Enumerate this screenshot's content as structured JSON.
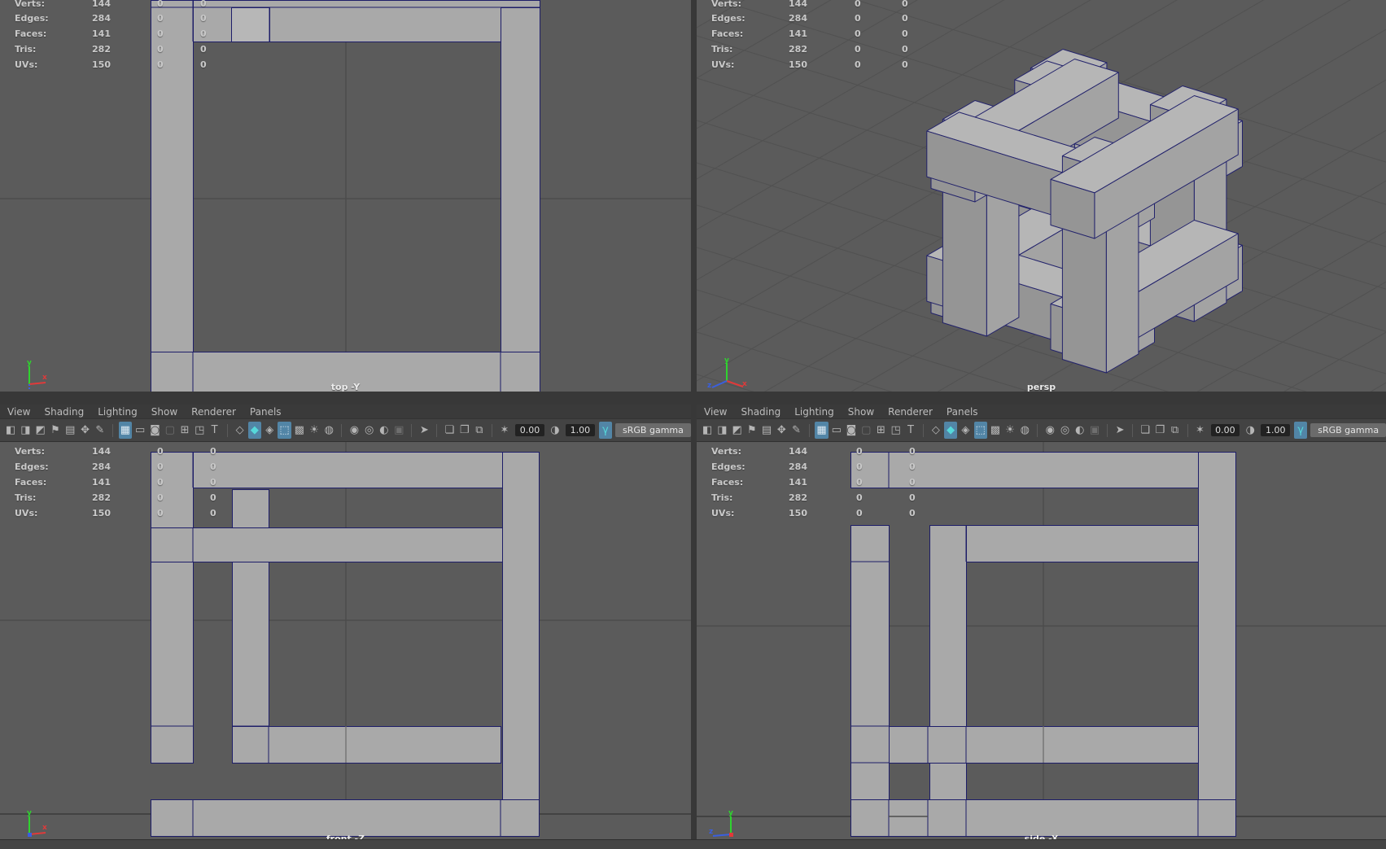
{
  "colors": {
    "viewport_bg": "#5b5b5b",
    "wireframe_edge": "#1d1d68",
    "mesh_fill": "#a9a9a9",
    "accent_highlight": "#5285a6",
    "teal_highlight": "#56d8da",
    "chrome": "#3a3a3a"
  },
  "menus": [
    "View",
    "Shading",
    "Lighting",
    "Show",
    "Renderer",
    "Panels"
  ],
  "stats": {
    "labels": [
      "Verts:",
      "Edges:",
      "Faces:",
      "Tris:",
      "UVs:"
    ],
    "values": [
      "144",
      "284",
      "141",
      "282",
      "150"
    ],
    "zero": "0"
  },
  "viewports": {
    "top": "top -Y",
    "persp": "persp",
    "front": "front -Z",
    "side": "side -X"
  },
  "axis": {
    "x": "x",
    "y": "y",
    "z": "z"
  },
  "toolbar": {
    "exposure": "0.00",
    "gamma": "1.00",
    "colorspace": "sRGB gamma",
    "icons": [
      {
        "type": "icon",
        "name": "camera-icon",
        "glyph": "◧"
      },
      {
        "type": "icon",
        "name": "camera-lock-icon",
        "glyph": "◨"
      },
      {
        "type": "icon",
        "name": "camera-settings-icon",
        "glyph": "◩"
      },
      {
        "type": "icon",
        "name": "bookmark-icon",
        "glyph": "⚑"
      },
      {
        "type": "icon",
        "name": "image-plane-icon",
        "glyph": "▤"
      },
      {
        "type": "icon",
        "name": "pan-zoom-icon",
        "glyph": "✥"
      },
      {
        "type": "icon",
        "name": "grease-pencil-icon",
        "glyph": "✎"
      },
      {
        "type": "sep"
      },
      {
        "type": "icon",
        "name": "grid-icon",
        "glyph": "▦",
        "state": "active"
      },
      {
        "type": "icon",
        "name": "film-gate-icon",
        "glyph": "▭"
      },
      {
        "type": "icon",
        "name": "resolution-gate-icon",
        "glyph": "◙"
      },
      {
        "type": "icon",
        "name": "gate-mask-icon",
        "glyph": "▢",
        "state": "dim"
      },
      {
        "type": "icon",
        "name": "field-chart-icon",
        "glyph": "⊞"
      },
      {
        "type": "icon",
        "name": "safe-action-icon",
        "glyph": "◳"
      },
      {
        "type": "icon",
        "name": "safe-title-icon",
        "glyph": "T"
      },
      {
        "type": "sep"
      },
      {
        "type": "icon",
        "name": "wireframe-icon",
        "glyph": "◇"
      },
      {
        "type": "icon",
        "name": "smooth-shade-icon",
        "glyph": "◆",
        "state": "teal"
      },
      {
        "type": "icon",
        "name": "textured-icon",
        "glyph": "◈"
      },
      {
        "type": "icon",
        "name": "wireframe-on-shaded-icon",
        "glyph": "⬚",
        "state": "active"
      },
      {
        "type": "icon",
        "name": "checker-icon",
        "glyph": "▩"
      },
      {
        "type": "icon",
        "name": "lights-icon",
        "glyph": "☀"
      },
      {
        "type": "icon",
        "name": "xray-icon",
        "glyph": "◍"
      },
      {
        "type": "sep"
      },
      {
        "type": "icon",
        "name": "default-light-icon",
        "glyph": "◉"
      },
      {
        "type": "icon",
        "name": "all-lights-icon",
        "glyph": "◎"
      },
      {
        "type": "icon",
        "name": "shadows-icon",
        "glyph": "◐"
      },
      {
        "type": "icon",
        "name": "occlusion-icon",
        "glyph": "▣",
        "state": "dim"
      },
      {
        "type": "sep"
      },
      {
        "type": "icon",
        "name": "select-tool-icon",
        "glyph": "➤"
      },
      {
        "type": "sep"
      },
      {
        "type": "icon",
        "name": "isolate-select-icon",
        "glyph": "❏"
      },
      {
        "type": "icon",
        "name": "isolate-add-icon",
        "glyph": "❐"
      },
      {
        "type": "icon",
        "name": "image-plane-toggle-icon",
        "glyph": "⧉"
      },
      {
        "type": "sep"
      },
      {
        "type": "icon",
        "name": "exposure-icon",
        "glyph": "✶"
      },
      {
        "type": "field",
        "name": "exposure-field",
        "key": "exposure"
      },
      {
        "type": "icon",
        "name": "contrast-icon",
        "glyph": "◑"
      },
      {
        "type": "field",
        "name": "gamma-field",
        "key": "gamma"
      },
      {
        "type": "icon",
        "name": "gamma-icon",
        "glyph": "γ",
        "state": "teal"
      },
      {
        "type": "button",
        "name": "colorspace-button",
        "key": "colorspace"
      }
    ]
  }
}
